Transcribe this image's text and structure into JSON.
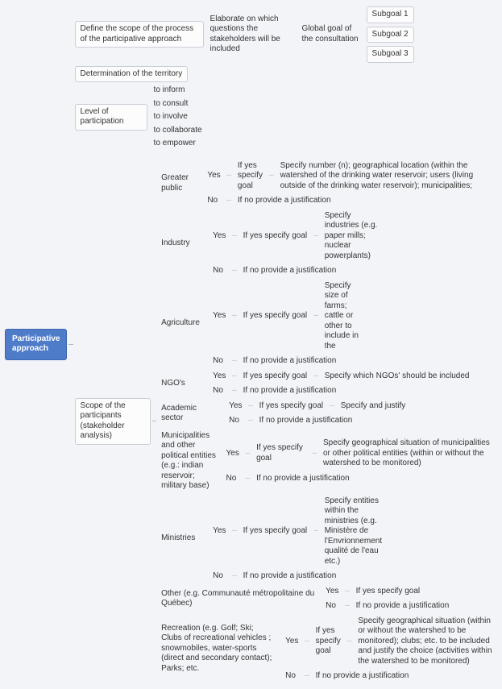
{
  "root": "Participative approach",
  "scope_process": "Define the scope of the process of the participative approach",
  "determination": "Determination of the territory",
  "elaborate": "Elaborate on which questions the stakeholders will be included",
  "global_goal": "Global goal of the consultation",
  "subgoal1": "Subgoal 1",
  "subgoal2": "Subgoal 2",
  "subgoal3": "Subgoal 3",
  "level_label": "Level of participation",
  "level": {
    "a": "to inform",
    "b": "to consult",
    "c": "to involve",
    "d": "to collaborate",
    "e": "to empower"
  },
  "scope_participants": "Scope of the participants (stakeholder analysis)",
  "yes": "Yes",
  "no": "No",
  "if_yes": "If yes specify goal",
  "if_no": "If no provide a justification",
  "cats": {
    "public": "Greater public",
    "industry": "Industry",
    "agriculture": "Agriculture",
    "ngos": "NGO's",
    "academic": "Academic sector",
    "muni": "Municipalities and other political entities (e.g.: indian reservoir; military base)",
    "ministries": "Ministries",
    "other": "Other (e.g. Communauté métropolitaine du Québec)",
    "recreation": "Recreation (e.g. Golf; Ski; Clubs of recreational vehicles ; snowmobiles, water-sports (direct and secondary contact); Parks; etc."
  },
  "detail": {
    "public": "Specify number (n); geographical location (within the watershed of the drinking water reservoir; users (living outside of the drinking water reservoir); municipalities;",
    "industry": "Specify industries (e.g. paper mills; nuclear powerplants)",
    "agriculture": "Specify size of farms; cattle or other to include in the",
    "ngos": "Specify which NGOs' should be included",
    "academic": "Specify and justify",
    "muni": "Specify geographical situation of municipalities or other political entities (within or without the watershed to be monitored)",
    "ministries": "Specify entities within the ministries (e.g. Ministère de l'Envrionnement qualité de l'eau etc.)",
    "recreation": "Specify geographical situation (within or without the watershed to be monitored); clubs; etc. to be included and justify the choice (activities within the watershed to be monitored)"
  }
}
